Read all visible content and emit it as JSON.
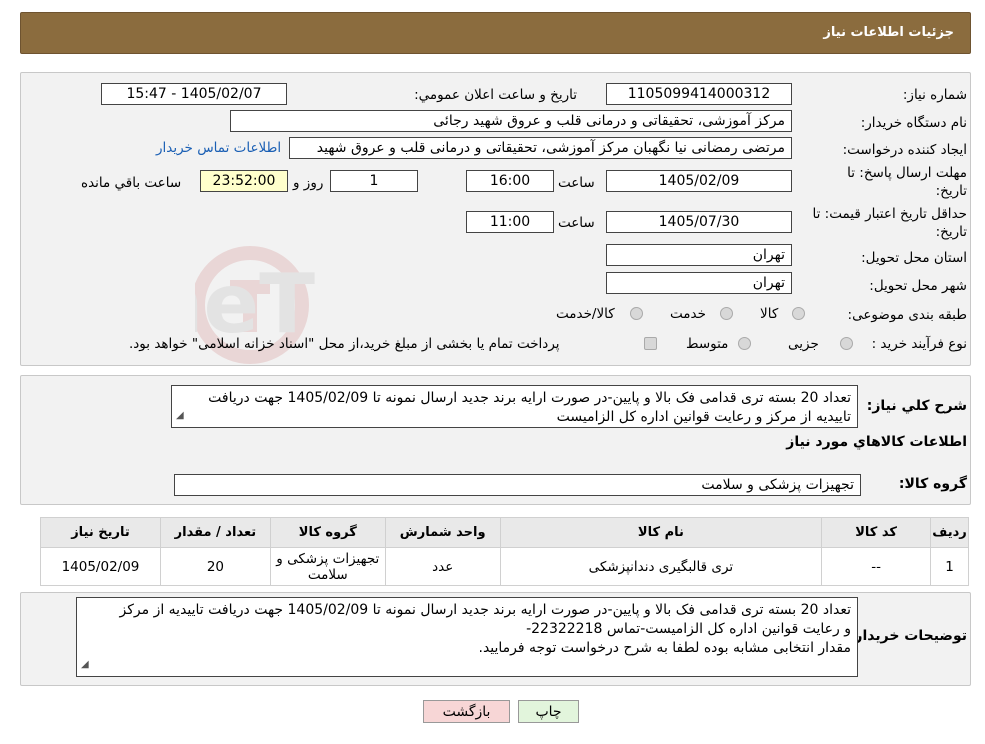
{
  "page": {
    "title": "جزئیات اطلاعات نیاز"
  },
  "form": {
    "need_number_label": "شماره نیاز:",
    "need_number": "1105099414000312",
    "announce_label": "تاريخ و ساعت اعلان عمومي:",
    "announce_value": "1405/02/07 - 15:47",
    "buyer_org_label": "نام دستگاه خریدار:",
    "buyer_org": "مرکز آموزشی، تحقیقاتی و درمانی قلب و عروق شهید رجائی",
    "creator_label": "ایجاد کننده درخواست:",
    "creator": "مرتضی رمضانی نیا نگهبان مرکز آموزشی، تحقیقاتی و درمانی قلب و عروق شهید",
    "contact_link": "اطلاعات تماس خریدار",
    "deadline_label1": "مهلت ارسال پاسخ: تا",
    "deadline_label2": "تاریخ:",
    "deadline_date": "1405/02/09",
    "time_label": "ساعت",
    "deadline_time": "16:00",
    "days_value": "1",
    "days_label": "روز و",
    "remaining_time": "23:52:00",
    "remaining_label": "ساعت باقي مانده",
    "validity_label1": "حداقل تاریخ اعتبار قیمت: تا",
    "validity_label2": "تاریخ:",
    "validity_date": "1405/07/30",
    "validity_time": "11:00",
    "province_label": "استان محل تحویل:",
    "province": "تهران",
    "city_label": "شهر محل تحویل:",
    "city": "تهران",
    "category_label": "طبقه بندی موضوعی:",
    "category_options": [
      "کالا",
      "خدمت",
      "کالا/خدمت"
    ],
    "process_label": "نوع فرآیند خرید :",
    "process_options": [
      "جزیی",
      "متوسط"
    ],
    "payment_note": "پرداخت تمام یا بخشی از مبلغ خرید،از محل \"اسناد خزانه اسلامی\" خواهد بود."
  },
  "summary": {
    "label": "شرح کلي نياز:",
    "text": "تعداد 20 بسته تری قدامی فک بالا و پایین-در صورت ارایه برند جدید ارسال نمونه تا 1405/02/09 جهت دریافت تاییدیه از مرکز و رعایت قوانین اداره کل الزامیست",
    "goods_heading": "اطلاعات کالاهاي مورد نياز",
    "group_label": "گروه کالا:",
    "group_value": "تجهیزات پزشکی و سلامت"
  },
  "table": {
    "headers": [
      "ردیف",
      "کد کالا",
      "نام کالا",
      "واحد شمارش",
      "گروه کالا",
      "تعداد / مقدار",
      "تاریخ نیاز"
    ],
    "rows": [
      [
        "1",
        "--",
        "تری قالبگیری دندانپزشکی",
        "عدد",
        "تجهیزات پزشکی و سلامت",
        "20",
        "1405/02/09"
      ]
    ]
  },
  "buyer_notes": {
    "label": "توضیحات خریدار:",
    "line1": "تعداد 20 بسته تری قدامی فک بالا و پایین-در صورت ارایه برند جدید ارسال نمونه تا 1405/02/09 جهت دریافت تاییدیه از مرکز",
    "line2": "و رعایت قوانین اداره کل الزامیست-تماس 22322218-",
    "line3": "مقدار انتخابی مشابه بوده لطفا به شرح درخواست توجه فرمایید."
  },
  "buttons": {
    "print": "چاپ",
    "back": "بازگشت"
  },
  "colors": {
    "header_bg": "#8b6c3e",
    "back_button_bg": "#f7d6d6",
    "print_button_bg": "#e2f5dc",
    "link": "#1a5fb4"
  },
  "watermark": {
    "brand": "AriaTender.neT"
  }
}
